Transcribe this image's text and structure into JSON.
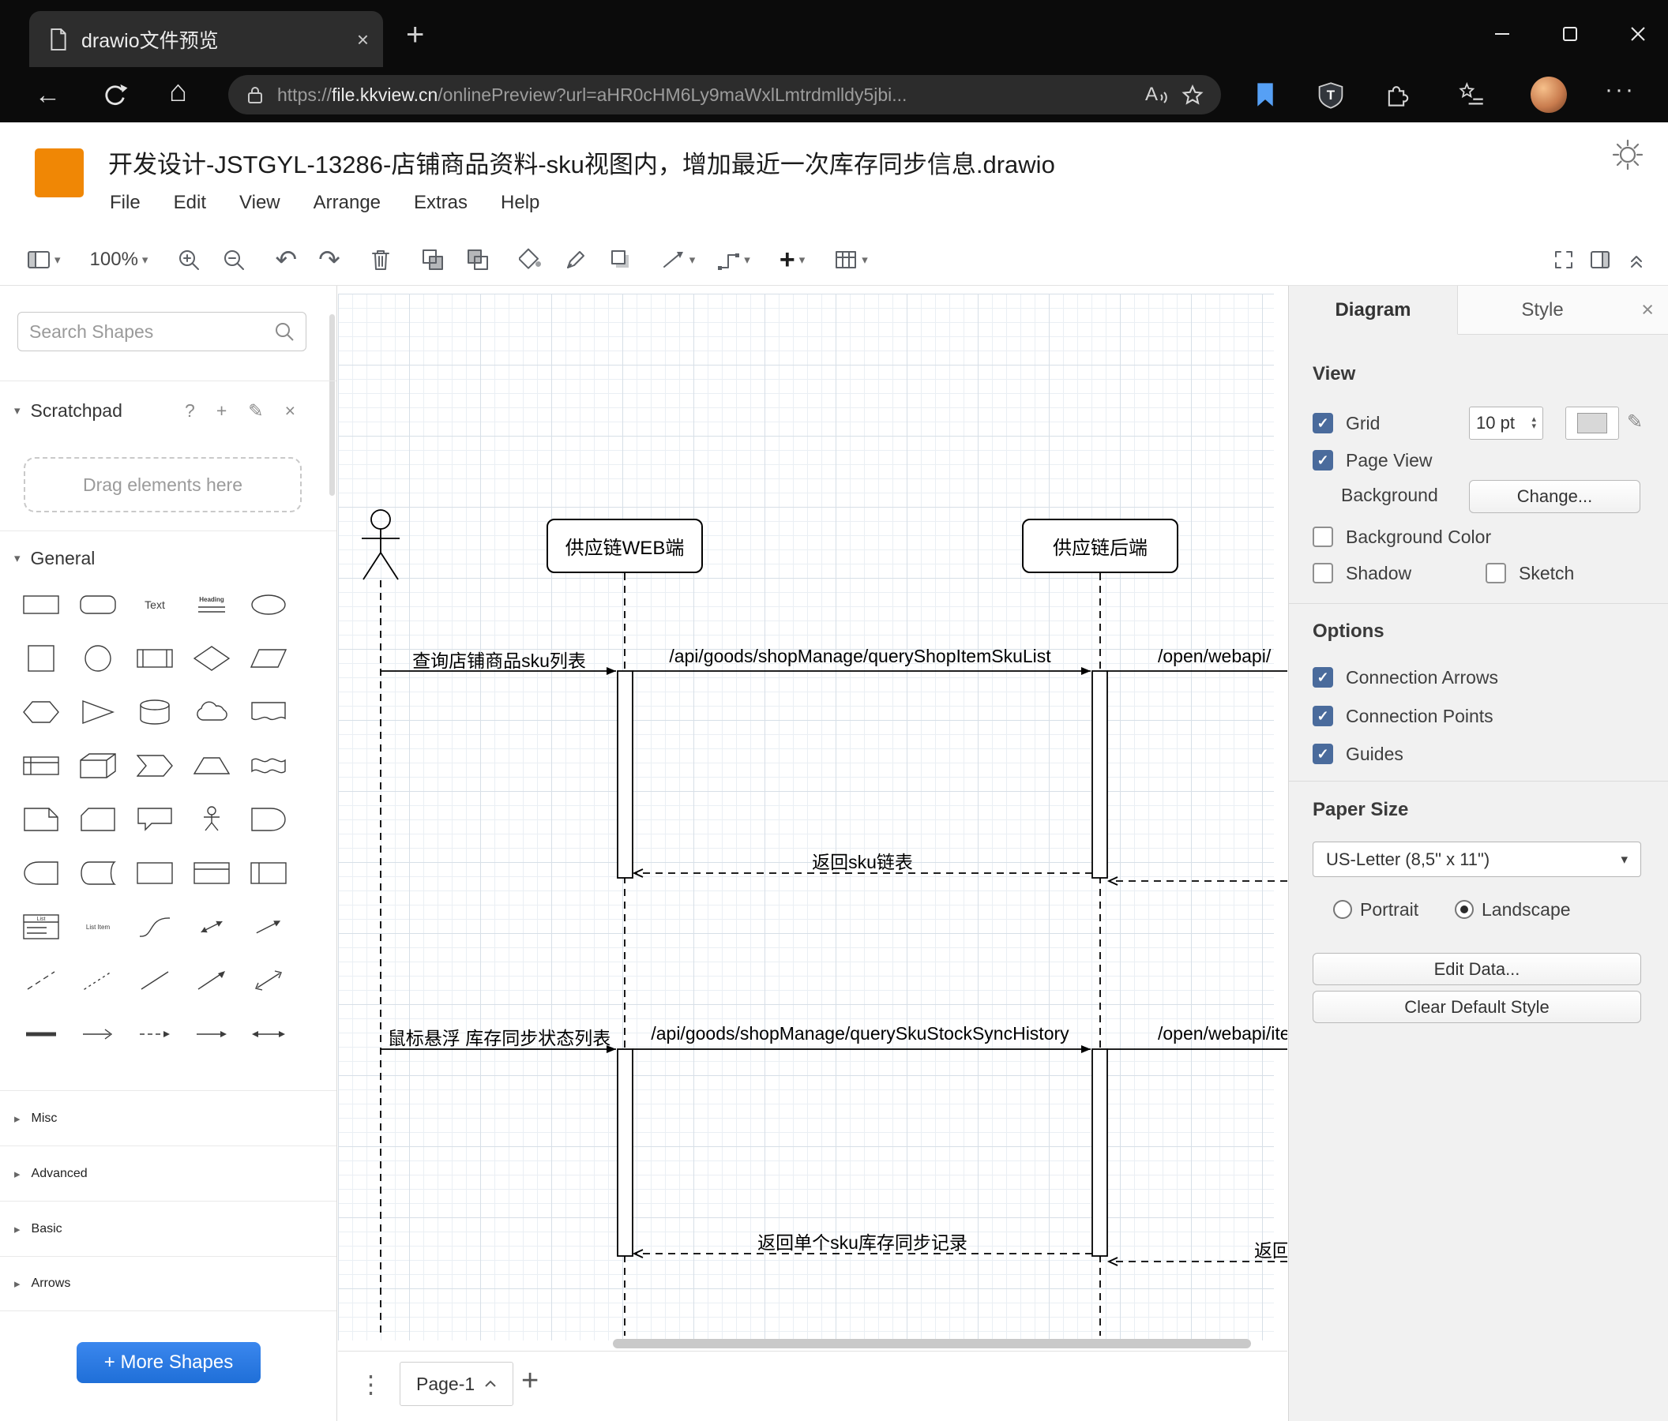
{
  "browser": {
    "tab_title": "drawio文件预览",
    "url_scheme": "https://",
    "url_domain": "file.kkview.cn",
    "url_rest": "/onlinePreview?url=aHR0cHM6Ly9maWxlLmtrdmlldy5jbi..."
  },
  "header": {
    "title": "开发设计-JSTGYL-13286-店铺商品资料-sku视图内，增加最近一次库存同步信息.drawio",
    "menus": [
      "File",
      "Edit",
      "View",
      "Arrange",
      "Extras",
      "Help"
    ]
  },
  "toolbar": {
    "zoom": "100%"
  },
  "icons": {
    "caret_down": "▾",
    "caret_right": "▸",
    "question": "?",
    "plus": "+",
    "pencil": "✎",
    "close": "×",
    "dots_v": "⋮",
    "dots_h": "···",
    "back": "←",
    "home": "⌂",
    "read_aloud": "A",
    "undo": "↶",
    "redo": "↷",
    "spin_up": "▴",
    "spin_down": "▾",
    "check": "✓"
  },
  "sidebar": {
    "search_placeholder": "Search Shapes",
    "scratchpad_label": "Scratchpad",
    "drag_hint": "Drag elements here",
    "general_label": "General",
    "shape_text_label": "Text",
    "shape_heading_label": "Heading",
    "shape_list_label": "List",
    "shape_list_item_label": "List Item",
    "sections": [
      "Misc",
      "Advanced",
      "Basic",
      "Arrows"
    ],
    "more_shapes_label": "+ More Shapes"
  },
  "canvas": {
    "participants": [
      "供应链WEB端",
      "供应链后端"
    ],
    "messages": {
      "m1": "查询店铺商品sku列表",
      "m2": "/api/goods/shopManage/queryShopItemSkuList",
      "m3": "/open/webapi/",
      "r1": "返回sku链表",
      "m4": "鼠标悬浮 库存同步状态列表",
      "m5": "/api/goods/shopManage/querySkuStockSyncHistory",
      "m6": "/open/webapi/item",
      "r2": "返回单个sku库存同步记录",
      "r3": "返回"
    }
  },
  "pagebar": {
    "page_label": "Page-1"
  },
  "format": {
    "tab_diagram": "Diagram",
    "tab_style": "Style",
    "view_heading": "View",
    "grid_label": "Grid",
    "grid_size": "10 pt",
    "page_view_label": "Page View",
    "background_label": "Background",
    "change_button": "Change...",
    "background_color_label": "Background Color",
    "shadow_label": "Shadow",
    "sketch_label": "Sketch",
    "options_heading": "Options",
    "connection_arrows_label": "Connection Arrows",
    "connection_points_label": "Connection Points",
    "guides_label": "Guides",
    "paper_size_heading": "Paper Size",
    "paper_size_value": "US-Letter (8,5\" x 11\")",
    "portrait_label": "Portrait",
    "landscape_label": "Landscape",
    "edit_data_button": "Edit Data...",
    "clear_default_style_button": "Clear Default Style"
  },
  "colors": {
    "accent_blue": "#2878e4",
    "logo_orange": "#f08705",
    "checkbox_blue": "#4a6b9c"
  }
}
